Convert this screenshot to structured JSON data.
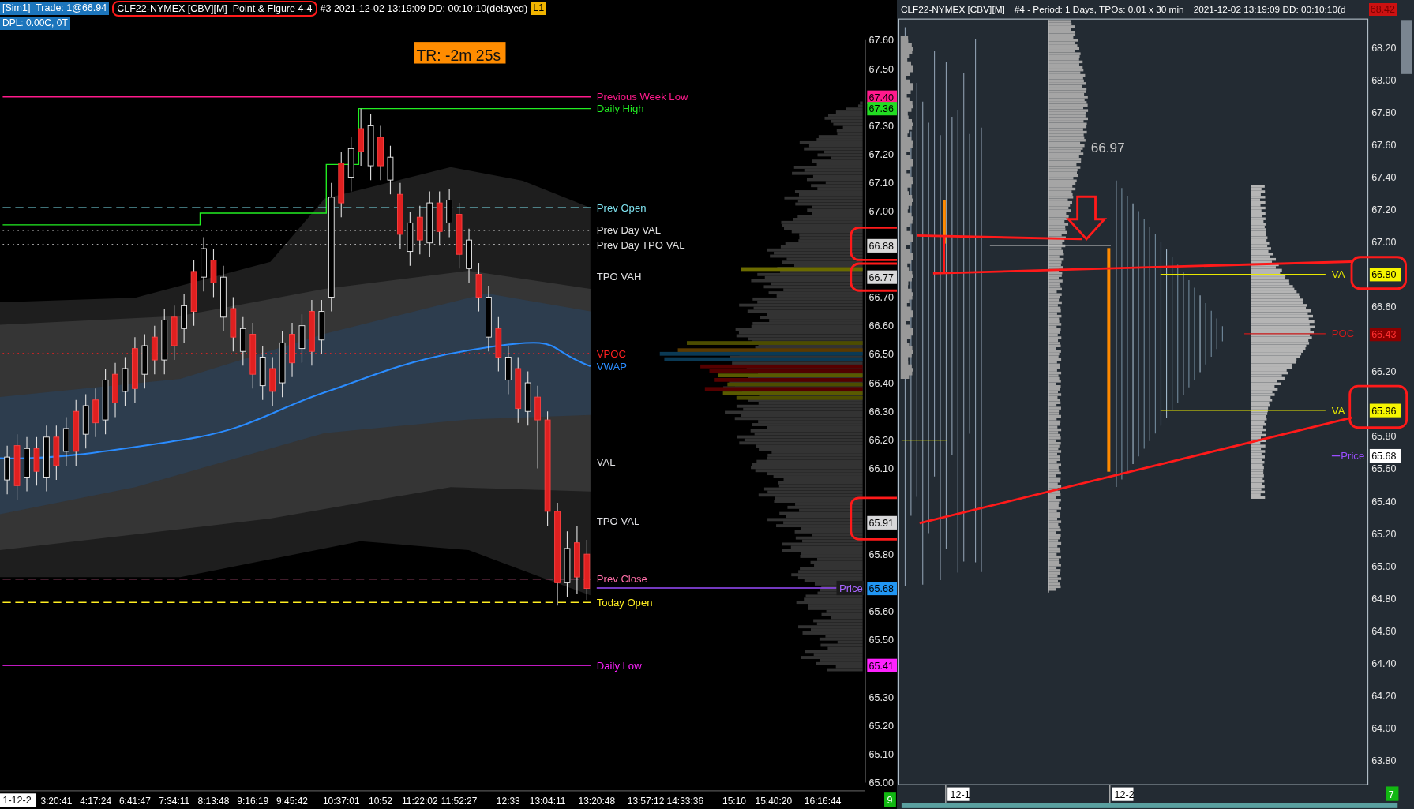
{
  "left_chart": {
    "account": "[Sim1]  Trade: 1@66.94",
    "instrument": "CLF22-NYMEX [CBV][M]  Point & Figure 4-4",
    "info": "#3 2021-12-02 13:19:09 DD: 00:10:10(delayed)",
    "feed_badge": "L1",
    "dpl": "DPL: 0.00C, 0T",
    "timer": "TR: -2m 25s",
    "chart_data": {
      "type": "candlestick",
      "categories": [
        null,
        null,
        null,
        null,
        null,
        "3:20:41",
        null,
        null,
        null,
        "4:17:24",
        null,
        null,
        null,
        "6:41:47",
        null,
        null,
        null,
        "7:34:11",
        null,
        null,
        null,
        "8:13:48",
        null,
        null,
        null,
        "9:16:19",
        null,
        null,
        null,
        "9:45:42",
        null,
        null,
        null,
        null,
        "10:37:01",
        null,
        null,
        null,
        "10:52",
        null,
        null,
        null,
        "11:22:02",
        null,
        null,
        null,
        "11:52:27",
        null,
        null,
        null,
        null,
        "12:33",
        null,
        null,
        null,
        "13:04:11",
        null,
        null,
        null,
        null,
        "13:20:48",
        null,
        null,
        null,
        null,
        "13:57:12",
        null,
        null,
        null,
        "14:33:36",
        null,
        null,
        null,
        null,
        "15:10",
        null,
        null,
        null,
        "15:40:20",
        null,
        null,
        null,
        null,
        "16:16:44",
        null,
        null,
        null,
        null
      ],
      "ohlc": [
        [
          66.06,
          66.18,
          66.01,
          66.14
        ],
        [
          66.18,
          66.22,
          65.99,
          66.04
        ],
        [
          66.07,
          66.21,
          66.02,
          66.17
        ],
        [
          66.17,
          66.21,
          66.04,
          66.09
        ],
        [
          66.07,
          66.25,
          66.02,
          66.21
        ],
        [
          66.21,
          66.25,
          66.06,
          66.11
        ],
        [
          66.16,
          66.28,
          66.11,
          66.24
        ],
        [
          66.3,
          66.34,
          66.11,
          66.16
        ],
        [
          66.22,
          66.36,
          66.17,
          66.32
        ],
        [
          66.34,
          66.38,
          66.21,
          66.26
        ],
        [
          66.27,
          66.45,
          66.22,
          66.41
        ],
        [
          66.43,
          66.47,
          66.28,
          66.33
        ],
        [
          66.37,
          66.49,
          66.32,
          66.45
        ],
        [
          66.52,
          66.56,
          66.33,
          66.38
        ],
        [
          66.43,
          66.57,
          66.38,
          66.53
        ],
        [
          66.56,
          66.6,
          66.43,
          66.48
        ],
        [
          66.48,
          66.66,
          66.43,
          66.62
        ],
        [
          66.63,
          66.67,
          66.48,
          66.53
        ],
        [
          66.59,
          66.71,
          66.54,
          66.67
        ],
        [
          66.79,
          66.83,
          66.6,
          66.65
        ],
        [
          66.77,
          66.91,
          66.72,
          66.87
        ],
        [
          66.83,
          66.87,
          66.7,
          66.75
        ],
        [
          66.63,
          66.81,
          66.58,
          66.77
        ],
        [
          66.66,
          66.7,
          66.51,
          66.56
        ],
        [
          66.51,
          66.63,
          66.46,
          66.59
        ],
        [
          66.57,
          66.61,
          66.38,
          66.43
        ],
        [
          66.39,
          66.53,
          66.34,
          66.49
        ],
        [
          66.45,
          66.49,
          66.32,
          66.37
        ],
        [
          66.4,
          66.58,
          66.35,
          66.54
        ],
        [
          66.57,
          66.61,
          66.42,
          66.47
        ],
        [
          66.52,
          66.64,
          66.47,
          66.6
        ],
        [
          66.65,
          66.69,
          66.46,
          66.51
        ],
        [
          66.55,
          66.69,
          66.5,
          66.65
        ],
        [
          66.7,
          67.1,
          66.65,
          67.05
        ],
        [
          67.17,
          67.21,
          66.98,
          67.03
        ],
        [
          67.12,
          67.26,
          67.07,
          67.22
        ],
        [
          67.29,
          67.36,
          67.16,
          67.21
        ],
        [
          67.16,
          67.34,
          67.11,
          67.3
        ],
        [
          67.26,
          67.3,
          67.11,
          67.16
        ],
        [
          67.11,
          67.23,
          67.06,
          67.19
        ],
        [
          67.06,
          67.1,
          66.87,
          66.92
        ],
        [
          66.86,
          67.0,
          66.81,
          66.96
        ],
        [
          66.98,
          67.02,
          66.85,
          66.9
        ],
        [
          66.89,
          67.07,
          66.84,
          67.03
        ],
        [
          67.03,
          67.07,
          66.88,
          66.93
        ],
        [
          66.96,
          67.08,
          66.91,
          67.04
        ],
        [
          66.99,
          67.03,
          66.8,
          66.85
        ],
        [
          66.8,
          66.94,
          66.75,
          66.9
        ],
        [
          66.78,
          66.82,
          66.65,
          66.7
        ],
        [
          66.56,
          66.74,
          66.51,
          66.7
        ],
        [
          66.59,
          66.63,
          66.44,
          66.49
        ],
        [
          66.41,
          66.53,
          66.36,
          66.49
        ],
        [
          66.45,
          66.49,
          66.26,
          66.31
        ],
        [
          66.3,
          66.44,
          66.25,
          66.4
        ],
        [
          66.35,
          66.39,
          66.1,
          66.27
        ],
        [
          66.27,
          66.3,
          65.9,
          65.95
        ],
        [
          65.95,
          65.98,
          65.62,
          65.7
        ],
        [
          65.7,
          65.88,
          65.65,
          65.82
        ],
        [
          65.84,
          65.9,
          65.66,
          65.72
        ],
        [
          65.8,
          65.85,
          65.64,
          65.68
        ],
        null,
        null,
        null,
        null,
        null,
        null,
        null,
        null,
        null,
        null,
        null,
        null,
        null,
        null,
        null,
        null,
        null,
        null,
        null,
        null,
        null,
        null,
        null,
        null,
        null,
        null,
        null,
        null
      ],
      "ylim": [
        65.0,
        67.6
      ],
      "yticks": [
        {
          "value": 67.6,
          "label": "67.60"
        },
        {
          "value": 67.5,
          "label": "67.50"
        },
        {
          "value": 67.3,
          "label": "67.30"
        },
        {
          "value": 67.2,
          "label": "67.20"
        },
        {
          "value": 67.1,
          "label": "67.10"
        },
        {
          "value": 67.0,
          "label": "67.00"
        },
        {
          "value": 66.7,
          "label": "66.70"
        },
        {
          "value": 66.6,
          "label": "66.60"
        },
        {
          "value": 66.5,
          "label": "66.50"
        },
        {
          "value": 66.4,
          "label": "66.40"
        },
        {
          "value": 66.3,
          "label": "66.30"
        },
        {
          "value": 66.2,
          "label": "66.20"
        },
        {
          "value": 66.1,
          "label": "66.10"
        },
        {
          "value": 65.8,
          "label": "65.80"
        },
        {
          "value": 65.6,
          "label": "65.60"
        },
        {
          "value": 65.5,
          "label": "65.50"
        },
        {
          "value": 65.3,
          "label": "65.30"
        },
        {
          "value": 65.2,
          "label": "65.20"
        },
        {
          "value": 65.1,
          "label": "65.10"
        },
        {
          "value": 65.0,
          "label": "65.00"
        }
      ]
    },
    "levels": [
      {
        "label": "Previous Week Low",
        "color": "#ff1a8c",
        "kind": "line"
      },
      {
        "label": "Daily High",
        "color": "#22ee22",
        "kind": "step"
      },
      {
        "label": "Prev Open",
        "color": "#7fe3f0",
        "kind": "dashes"
      },
      {
        "label": "Prev Day VAL",
        "color": "#e0e0e0",
        "kind": "dots"
      },
      {
        "label": "Prev Day TPO VAL",
        "color": "#e0e0e1",
        "kind": "dots"
      },
      {
        "label": "TPO VAH",
        "color": "#e0e0e2",
        "kind": "label"
      },
      {
        "label": "VPOC",
        "color": "#ff2020",
        "kind": "dots"
      },
      {
        "label": "VWAP",
        "color": "#2a8cff",
        "kind": "curve"
      },
      {
        "label": "VAL",
        "color": "#e0e0e3",
        "kind": "label"
      },
      {
        "label": "TPO VAL",
        "color": "#e0e0e4",
        "kind": "label"
      },
      {
        "label": "Prev Close",
        "color": "#ff6fa8",
        "kind": "dashes"
      },
      {
        "label": "Today Open",
        "color": "#ffee22",
        "kind": "dashes"
      },
      {
        "label": "Daily Low",
        "color": "#ff22ff",
        "kind": "line"
      }
    ],
    "price_marker": "Price",
    "price_badges": [
      {
        "text": "67.40",
        "color": "#ff1a8c"
      },
      {
        "text": "67.36",
        "color": "#22dd22"
      },
      {
        "text": "66.88",
        "color": "#d8d8d8"
      },
      {
        "text": "66.77",
        "color": "#d8d8d9"
      },
      {
        "text": "65.91",
        "color": "#d8d8da"
      },
      {
        "text": "65.68",
        "color": "#2196f3"
      },
      {
        "text": "65.41",
        "color": "#ff22ff"
      }
    ],
    "date_label": "1-12-2",
    "bar_count": "9"
  },
  "right_chart": {
    "instrument": "CLF22-NYMEX [CBV][M]",
    "period": "#4 - Period: 1 Days, TPOs: 0.01 x 30 min",
    "info": "2021-12-02 13:19:09 DD: 00:10:10(d",
    "poc_value": "66.97",
    "levels": [
      {
        "label": "VA",
        "color": "#e8e800"
      },
      {
        "label": "POC",
        "color": "#cc1a1a"
      },
      {
        "label": "VA",
        "color": "#e8e801"
      }
    ],
    "price_marker": "Price",
    "price_ticks": [
      "68.20",
      "68.00",
      "67.80",
      "67.60",
      "67.40",
      "67.20",
      "67.00",
      "66.60",
      "66.20",
      "65.80",
      "65.60",
      "65.40",
      "65.20",
      "65.00",
      "64.80",
      "64.60",
      "64.40",
      "64.20",
      "64.00",
      "63.80"
    ],
    "price_badges": [
      {
        "text": "68.42",
        "color": "#cc1111"
      },
      {
        "text": "66.80",
        "color": "#f5f500"
      },
      {
        "text": "66.43",
        "color": "#8b0000"
      },
      {
        "text": "65.96",
        "color": "#f5f501"
      },
      {
        "text": "65.68",
        "color": "#ffffff"
      }
    ],
    "date_labels": [
      "12-1",
      "12-2"
    ],
    "bar_count": "7"
  }
}
